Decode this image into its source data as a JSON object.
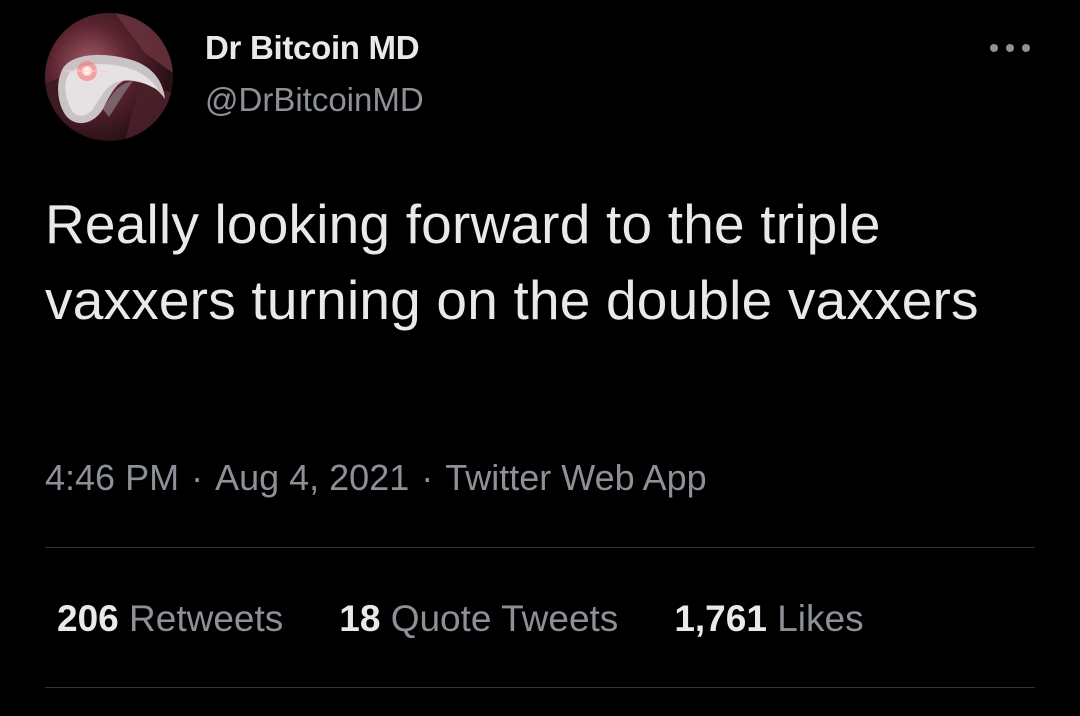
{
  "tweet": {
    "author": {
      "display_name": "Dr Bitcoin MD",
      "handle": "@DrBitcoinMD",
      "avatar_icon": "plague-doctor-mask-icon"
    },
    "more_icon": "ellipsis-icon",
    "text": "Really looking forward to the triple vaxxers turning on the double vaxxers",
    "time": "4:46 PM",
    "date": "Aug 4, 2021",
    "separator": "·",
    "source": "Twitter Web App",
    "stats": {
      "retweets": {
        "count": "206",
        "label": "Retweets"
      },
      "quote_tweets": {
        "count": "18",
        "label": "Quote Tweets"
      },
      "likes": {
        "count": "1,761",
        "label": "Likes"
      }
    }
  },
  "colors": {
    "background": "#000000",
    "primary_text": "#e7e9ea",
    "secondary_text": "#8b9197",
    "divider": "#2f3336"
  }
}
